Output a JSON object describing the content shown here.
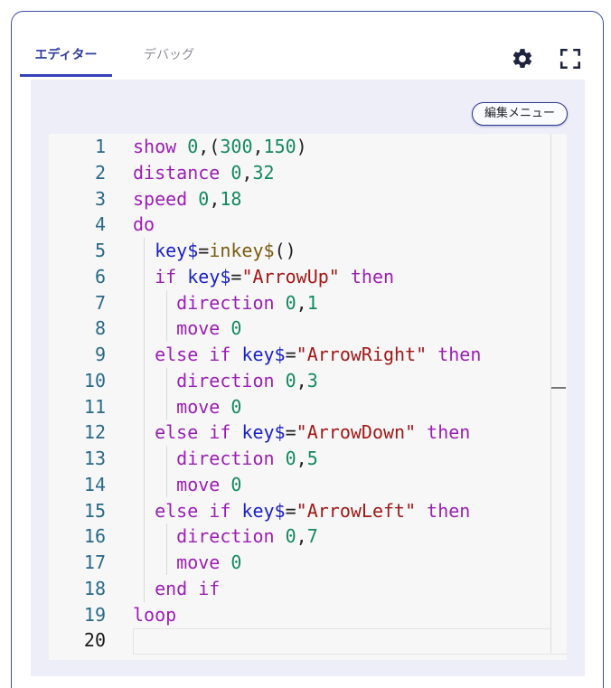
{
  "tabs": [
    {
      "label": "エディター",
      "active": true
    },
    {
      "label": "デバッグ",
      "active": false
    }
  ],
  "toolbar": {
    "settings_icon": "gear-icon",
    "fullscreen_icon": "fullscreen-icon"
  },
  "edit_menu_label": "編集メニュー",
  "colors": {
    "accent": "#3441b8",
    "keyword": "#9b1fb5",
    "number": "#138a60",
    "variable": "#1b21c8",
    "function": "#7a5c0f",
    "string": "#a21818",
    "panel": "#eeeef9"
  },
  "editor": {
    "current_line": 20,
    "lines": [
      {
        "n": "1",
        "indent": 0,
        "tokens": [
          {
            "t": "show",
            "c": "kw"
          },
          {
            "t": " "
          },
          {
            "t": "0",
            "c": "num"
          },
          {
            "t": ",("
          },
          {
            "t": "300",
            "c": "num"
          },
          {
            "t": ","
          },
          {
            "t": "150",
            "c": "num"
          },
          {
            "t": ")"
          }
        ]
      },
      {
        "n": "2",
        "indent": 0,
        "tokens": [
          {
            "t": "distance",
            "c": "kw"
          },
          {
            "t": " "
          },
          {
            "t": "0",
            "c": "num"
          },
          {
            "t": ","
          },
          {
            "t": "32",
            "c": "num"
          }
        ]
      },
      {
        "n": "3",
        "indent": 0,
        "tokens": [
          {
            "t": "speed",
            "c": "kw"
          },
          {
            "t": " "
          },
          {
            "t": "0",
            "c": "num"
          },
          {
            "t": ","
          },
          {
            "t": "18",
            "c": "num"
          }
        ]
      },
      {
        "n": "4",
        "indent": 0,
        "tokens": [
          {
            "t": "do",
            "c": "kw"
          }
        ]
      },
      {
        "n": "5",
        "indent": 1,
        "tokens": [
          {
            "t": "key$",
            "c": "var"
          },
          {
            "t": "="
          },
          {
            "t": "inkey$",
            "c": "fn"
          },
          {
            "t": "()"
          }
        ]
      },
      {
        "n": "6",
        "indent": 1,
        "tokens": [
          {
            "t": "if",
            "c": "kw"
          },
          {
            "t": " "
          },
          {
            "t": "key$",
            "c": "var"
          },
          {
            "t": "="
          },
          {
            "t": "\"ArrowUp\"",
            "c": "str"
          },
          {
            "t": " "
          },
          {
            "t": "then",
            "c": "kw"
          }
        ]
      },
      {
        "n": "7",
        "indent": 2,
        "tokens": [
          {
            "t": "direction",
            "c": "kw"
          },
          {
            "t": " "
          },
          {
            "t": "0",
            "c": "num"
          },
          {
            "t": ","
          },
          {
            "t": "1",
            "c": "num"
          }
        ]
      },
      {
        "n": "8",
        "indent": 2,
        "tokens": [
          {
            "t": "move",
            "c": "kw"
          },
          {
            "t": " "
          },
          {
            "t": "0",
            "c": "num"
          }
        ]
      },
      {
        "n": "9",
        "indent": 1,
        "tokens": [
          {
            "t": "else if",
            "c": "kw"
          },
          {
            "t": " "
          },
          {
            "t": "key$",
            "c": "var"
          },
          {
            "t": "="
          },
          {
            "t": "\"ArrowRight\"",
            "c": "str"
          },
          {
            "t": " "
          },
          {
            "t": "then",
            "c": "kw"
          }
        ]
      },
      {
        "n": "10",
        "indent": 2,
        "tokens": [
          {
            "t": "direction",
            "c": "kw"
          },
          {
            "t": " "
          },
          {
            "t": "0",
            "c": "num"
          },
          {
            "t": ","
          },
          {
            "t": "3",
            "c": "num"
          }
        ]
      },
      {
        "n": "11",
        "indent": 2,
        "tokens": [
          {
            "t": "move",
            "c": "kw"
          },
          {
            "t": " "
          },
          {
            "t": "0",
            "c": "num"
          }
        ]
      },
      {
        "n": "12",
        "indent": 1,
        "tokens": [
          {
            "t": "else if",
            "c": "kw"
          },
          {
            "t": " "
          },
          {
            "t": "key$",
            "c": "var"
          },
          {
            "t": "="
          },
          {
            "t": "\"ArrowDown\"",
            "c": "str"
          },
          {
            "t": " "
          },
          {
            "t": "then",
            "c": "kw"
          }
        ]
      },
      {
        "n": "13",
        "indent": 2,
        "tokens": [
          {
            "t": "direction",
            "c": "kw"
          },
          {
            "t": " "
          },
          {
            "t": "0",
            "c": "num"
          },
          {
            "t": ","
          },
          {
            "t": "5",
            "c": "num"
          }
        ]
      },
      {
        "n": "14",
        "indent": 2,
        "tokens": [
          {
            "t": "move",
            "c": "kw"
          },
          {
            "t": " "
          },
          {
            "t": "0",
            "c": "num"
          }
        ]
      },
      {
        "n": "15",
        "indent": 1,
        "tokens": [
          {
            "t": "else if",
            "c": "kw"
          },
          {
            "t": " "
          },
          {
            "t": "key$",
            "c": "var"
          },
          {
            "t": "="
          },
          {
            "t": "\"ArrowLeft\"",
            "c": "str"
          },
          {
            "t": " "
          },
          {
            "t": "then",
            "c": "kw"
          }
        ]
      },
      {
        "n": "16",
        "indent": 2,
        "tokens": [
          {
            "t": "direction",
            "c": "kw"
          },
          {
            "t": " "
          },
          {
            "t": "0",
            "c": "num"
          },
          {
            "t": ","
          },
          {
            "t": "7",
            "c": "num"
          }
        ]
      },
      {
        "n": "17",
        "indent": 2,
        "tokens": [
          {
            "t": "move",
            "c": "kw"
          },
          {
            "t": " "
          },
          {
            "t": "0",
            "c": "num"
          }
        ]
      },
      {
        "n": "18",
        "indent": 1,
        "tokens": [
          {
            "t": "end if",
            "c": "kw"
          }
        ]
      },
      {
        "n": "19",
        "indent": 0,
        "tokens": [
          {
            "t": "loop",
            "c": "kw"
          }
        ]
      },
      {
        "n": "20",
        "indent": 0,
        "tokens": []
      }
    ]
  }
}
